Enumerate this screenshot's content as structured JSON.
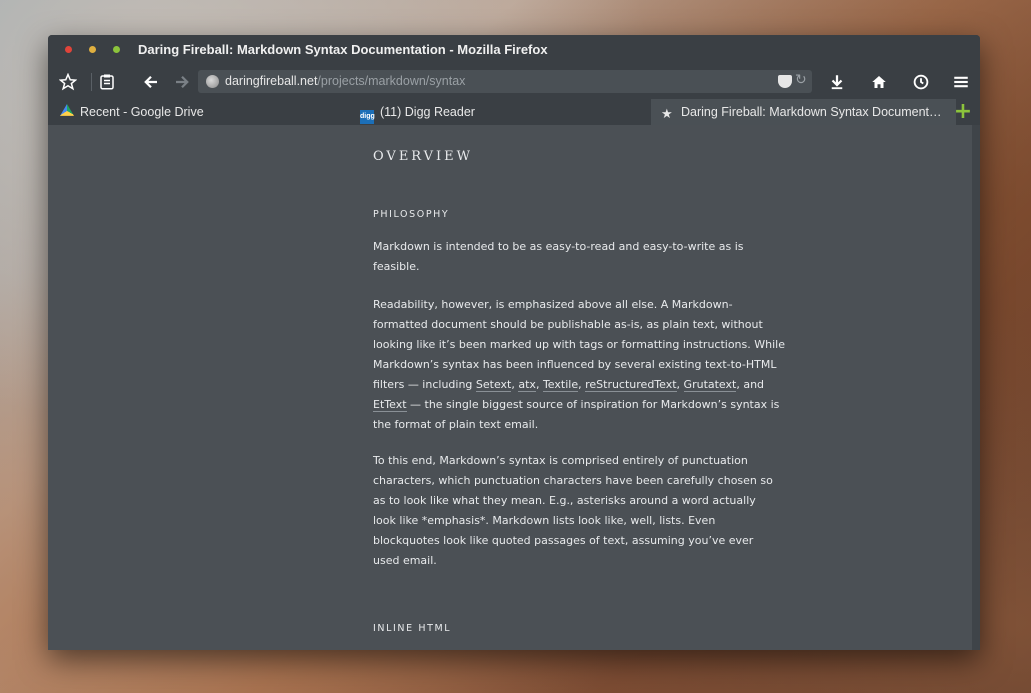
{
  "window": {
    "title": "Daring Fireball: Markdown Syntax Documentation - Mozilla Firefox"
  },
  "toolbar": {
    "url_host": "daringfireball.net",
    "url_path": "/projects/markdown/syntax"
  },
  "tabs": [
    {
      "label": "Recent - Google Drive",
      "icon": "google-drive-icon"
    },
    {
      "label": "(11) Digg Reader",
      "icon": "digg-icon"
    },
    {
      "label": "Daring Fireball: Markdown Syntax Document…",
      "icon": "star-icon"
    }
  ],
  "article": {
    "overview_heading": "OVERVIEW",
    "philosophy_heading": "PHILOSOPHY",
    "para1": "Markdown is intended to be as easy-to-read and easy-to-write as is feasible.",
    "para2_lines": [
      "Readability, however, is emphasized above all else. A Markdown-",
      "formatted document should be publishable as-is, as plain text, without",
      "looking like it’s been marked up with tags or formatting instructions. While",
      "Markdown’s syntax has been influenced by several existing text-to-HTML"
    ],
    "para2_filters_prefix": "filters — including ",
    "links": [
      "Setext",
      "atx",
      "Textile",
      "reStructuredText",
      "Grutatext",
      "EtText"
    ],
    "para2_and": ", and",
    "para2_tail_line1": " — the single biggest source of inspiration for Markdown’s syntax is",
    "para2_tail_line2": "the format of plain text email.",
    "para3_lines": [
      "To this end, Markdown’s syntax is comprised entirely of punctuation",
      "characters, which punctuation characters have been carefully chosen so",
      "as to look like what they mean. E.g., asterisks around a word actually",
      "look like *emphasis*. Markdown lists look like, well, lists. Even",
      "blockquotes look like quoted passages of text, assuming you’ve ever",
      "used email."
    ],
    "inline_html_heading": "INLINE HTML"
  },
  "colors": {
    "content_bg": "#4b5055",
    "chrome_bg": "#3a3f44",
    "accent_green": "#8cc43c"
  }
}
